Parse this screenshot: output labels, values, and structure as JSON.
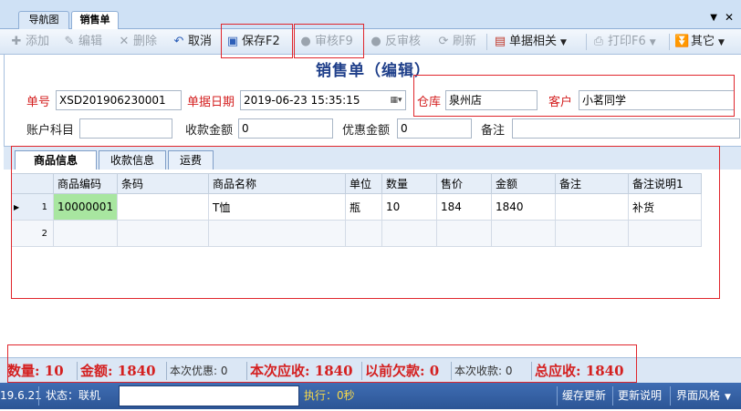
{
  "doc_tabs": {
    "nav_label": "导航图",
    "sales_label": "销售单",
    "arrow": "▼",
    "close": "✕"
  },
  "toolbar": {
    "add": "添加",
    "edit": "编辑",
    "delete": "删除",
    "cancel": "取消",
    "save": "保存F2",
    "audit": "审核F9",
    "unaudit": "反审核",
    "refresh": "刷新",
    "doc_related": "单据相关",
    "print": "打印F6",
    "other": "其它"
  },
  "form": {
    "title": "销售单（编辑）",
    "doc_no_label": "单号",
    "doc_no_value": "XSD201906230001",
    "date_label": "单据日期",
    "date_value": "2019-06-23 15:35:15",
    "warehouse_label": "仓库",
    "warehouse_value": "泉州店",
    "customer_label": "客户",
    "customer_value": "小茗同学",
    "account_label": "账户科目",
    "account_value": "",
    "received_label": "收款金额",
    "received_value": "0",
    "discount_label": "优惠金额",
    "discount_value": "0",
    "remark_label": "备注",
    "remark_value": ""
  },
  "sub_tabs": [
    "商品信息",
    "收款信息",
    "运费"
  ],
  "grid": {
    "columns": [
      "商品编码",
      "条码",
      "商品名称",
      "单位",
      "数量",
      "售价",
      "金额",
      "备注",
      "备注说明1"
    ],
    "rows": [
      {
        "num": "1",
        "cells": [
          "10000001",
          "",
          "T恤",
          "瓶",
          "10",
          "184",
          "1840",
          "",
          "补货"
        ]
      },
      {
        "num": "2",
        "cells": [
          "",
          "",
          "",
          "",
          "",
          "",
          "",
          "",
          ""
        ]
      }
    ]
  },
  "summary": {
    "qty": "数量: 10",
    "amount": "金额: 1840",
    "this_discount": "本次优惠: 0",
    "this_receivable": "本次应收: 1840",
    "previous_debt": "以前欠款: 0",
    "this_received": "本次收款: 0",
    "total_receivable": "总应收: 1840"
  },
  "status": {
    "version": "19.6.21",
    "state": "状态：联机",
    "exec": "执行：0秒",
    "cache_update": "缓存更新",
    "update_notes": "更新说明",
    "theme": "界面风格"
  },
  "colors": {
    "accent_red": "#d42020",
    "title_blue": "#1f3f8a",
    "status_blue": "#2c5595",
    "selected_cell": "#a8e6a0"
  }
}
